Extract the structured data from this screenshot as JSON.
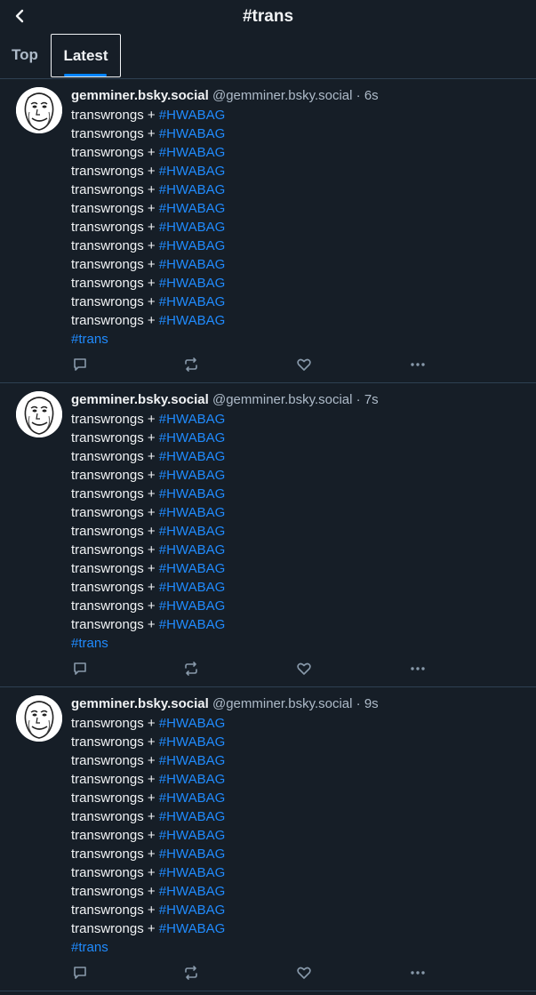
{
  "header": {
    "title": "#trans"
  },
  "tabs": [
    {
      "label": "Top"
    },
    {
      "label": "Latest"
    }
  ],
  "posts": [
    {
      "display_name": "gemminer.bsky.social",
      "handle": "@gemminer.bsky.social",
      "time": "· 6s",
      "line_text": "transwrongs + ",
      "line_tag": "#HWABAG",
      "final_tag": "#trans"
    },
    {
      "display_name": "gemminer.bsky.social",
      "handle": "@gemminer.bsky.social",
      "time": "· 7s",
      "line_text": "transwrongs + ",
      "line_tag": "#HWABAG",
      "final_tag": "#trans"
    },
    {
      "display_name": "gemminer.bsky.social",
      "handle": "@gemminer.bsky.social",
      "time": "· 9s",
      "line_text": "transwrongs + ",
      "line_tag": "#HWABAG",
      "final_tag": "#trans"
    }
  ],
  "icons": {
    "back": "chevron-left-icon",
    "reply": "speech-bubble-icon",
    "repost": "repost-arrows-icon",
    "like": "heart-icon",
    "more": "ellipsis-icon"
  }
}
